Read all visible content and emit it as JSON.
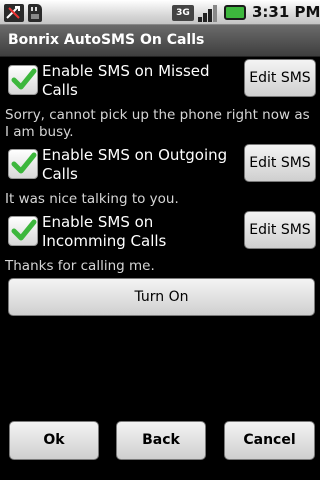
{
  "status_bar": {
    "network_badge": "3G",
    "time": "3:31 PM",
    "icons": [
      "usb-debug-icon",
      "sd-card-icon",
      "3g-icon",
      "signal-icon",
      "battery-icon"
    ]
  },
  "title": "Bonrix AutoSMS On Calls",
  "options": [
    {
      "label": "Enable SMS on Missed Calls",
      "checked": true,
      "edit_label": "Edit SMS",
      "message": "Sorry, cannot pick up the phone right now as I am busy."
    },
    {
      "label": "Enable SMS on Outgoing Calls",
      "checked": true,
      "edit_label": "Edit SMS",
      "message": "It was nice talking to you."
    },
    {
      "label": "Enable SMS on Incomming Calls",
      "checked": true,
      "edit_label": "Edit SMS",
      "message": "Thanks for calling me."
    }
  ],
  "turn_on_label": "Turn On",
  "bottom_buttons": {
    "ok": "Ok",
    "back": "Back",
    "cancel": "Cancel"
  },
  "colors": {
    "check": "#3db73d",
    "background": "#000000"
  }
}
